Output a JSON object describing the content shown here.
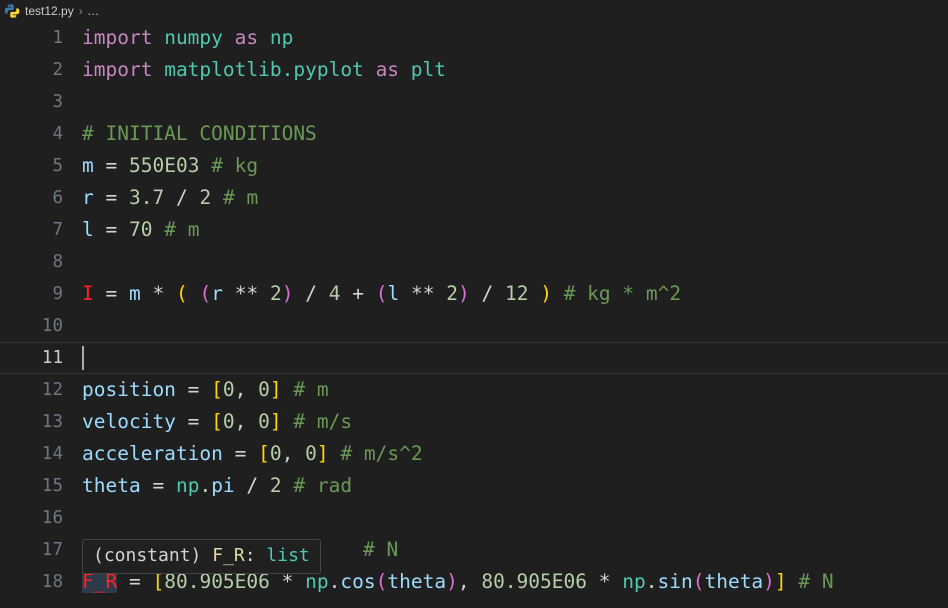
{
  "breadcrumb": {
    "icon": "python-file-icon",
    "file": "test12.py",
    "separator": "›",
    "more": "..."
  },
  "editor": {
    "language": "python",
    "active_line": 11,
    "theme_background": "#1f1f1f",
    "lines": [
      {
        "n": "1",
        "text": "import numpy as np"
      },
      {
        "n": "2",
        "text": "import matplotlib.pyplot as plt"
      },
      {
        "n": "3",
        "text": ""
      },
      {
        "n": "4",
        "text": "# INITIAL CONDITIONS"
      },
      {
        "n": "5",
        "text": "m = 550E03 # kg"
      },
      {
        "n": "6",
        "text": "r = 3.7 / 2 # m"
      },
      {
        "n": "7",
        "text": "l = 70 # m"
      },
      {
        "n": "8",
        "text": ""
      },
      {
        "n": "9",
        "text": "I = m * ( (r ** 2) / 4 + (l ** 2) / 12 ) # kg * m^2"
      },
      {
        "n": "10",
        "text": ""
      },
      {
        "n": "11",
        "text": ""
      },
      {
        "n": "12",
        "text": "position = [0, 0] # m"
      },
      {
        "n": "13",
        "text": "velocity = [0, 0] # m/s"
      },
      {
        "n": "14",
        "text": "acceleration = [0, 0] # m/s^2"
      },
      {
        "n": "15",
        "text": "theta = np.pi / 2 # rad"
      },
      {
        "n": "16",
        "text": ""
      },
      {
        "n": "17",
        "text": " # N"
      },
      {
        "n": "18",
        "text": "F_R = [80.905E06 * np.cos(theta), 80.905E06 * np.sin(theta)] # N"
      }
    ]
  },
  "hover_tooltip": {
    "kind": "(constant)",
    "name": "F_R",
    "colon": ":",
    "type": "list"
  },
  "tokens": {
    "l1": {
      "import": "import",
      "numpy": "numpy",
      "as": "as",
      "np": "np"
    },
    "l2": {
      "import": "import",
      "matplotlib": "matplotlib",
      "dot": ".",
      "pyplot": "pyplot",
      "as": "as",
      "plt": "plt"
    },
    "l4": {
      "comment": "# INITIAL CONDITIONS"
    },
    "l5": {
      "var": "m",
      "eq": "=",
      "num": "550E03",
      "comment": "# kg"
    },
    "l6": {
      "var": "r",
      "eq": "=",
      "num1": "3.7",
      "div": "/",
      "num2": "2",
      "comment": "# m"
    },
    "l7": {
      "var": "l",
      "eq": "=",
      "num": "70",
      "comment": "# m"
    },
    "l9": {
      "const": "I",
      "eq": "=",
      "m": "m",
      "mul1": "*",
      "p_open": "(",
      "p2_open": "(",
      "r": "r",
      "pow1": "**",
      "two1": "2",
      "p2_close": ")",
      "div1": "/",
      "four": "4",
      "plus": "+",
      "p3_open": "(",
      "l": "l",
      "pow2": "**",
      "two2": "2",
      "p3_close": ")",
      "div2": "/",
      "twelve": "12",
      "p_close": ")",
      "comment": "# kg * m^2"
    },
    "l12": {
      "var": "position",
      "eq": "=",
      "br_open": "[",
      "z1": "0",
      "comma": ",",
      "z2": "0",
      "br_close": "]",
      "comment": "# m"
    },
    "l13": {
      "var": "velocity",
      "eq": "=",
      "br_open": "[",
      "z1": "0",
      "comma": ",",
      "z2": "0",
      "br_close": "]",
      "comment": "# m/s"
    },
    "l14": {
      "var": "acceleration",
      "eq": "=",
      "br_open": "[",
      "z1": "0",
      "comma": ",",
      "z2": "0",
      "br_close": "]",
      "comment": "# m/s^2"
    },
    "l15": {
      "var": "theta",
      "eq": "=",
      "np": "np",
      "dot": ".",
      "pi": "pi",
      "div": "/",
      "two": "2",
      "comment": "# rad"
    },
    "l17": {
      "comment": "# N"
    },
    "l18": {
      "const": "F_R",
      "eq": "=",
      "br_open": "[",
      "num1": "80.905E06",
      "mul1": "*",
      "np1": "np",
      "dot1": ".",
      "cos": "cos",
      "p1_open": "(",
      "theta1": "theta",
      "p1_close": ")",
      "comma": ",",
      "num2": "80.905E06",
      "mul2": "*",
      "np2": "np",
      "dot2": ".",
      "sin": "sin",
      "p2_open": "(",
      "theta2": "theta",
      "p2_close": ")",
      "br_close": "]",
      "comment": "# N"
    }
  },
  "colors": {
    "background": "#1f1f1f",
    "keyword": "#c586c0",
    "module": "#4ec9b0",
    "variable": "#9cdcfe",
    "number": "#b5cea8",
    "comment": "#6a9955",
    "operator": "#d4d4d4",
    "constant": "#ff2222",
    "bracket1": "#ffd700",
    "bracket2": "#da70d6",
    "line_number": "#6e7681",
    "line_number_active": "#cccccc"
  }
}
